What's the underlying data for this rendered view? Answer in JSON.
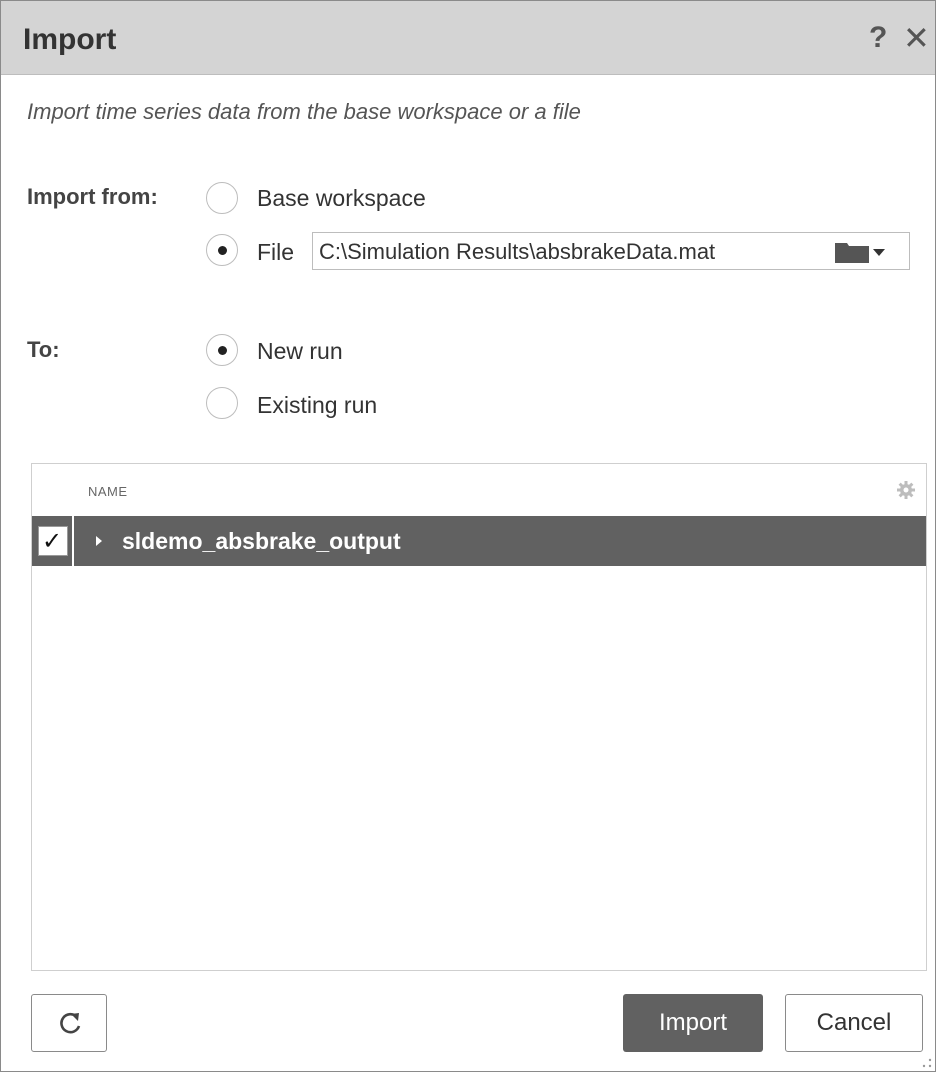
{
  "dialog": {
    "title": "Import",
    "help_label": "?",
    "close_label": "✕"
  },
  "description": "Import time series data from the base workspace or a file",
  "import_from": {
    "label": "Import from:",
    "options": [
      {
        "label": "Base workspace",
        "checked": false
      },
      {
        "label": "File",
        "checked": true
      }
    ],
    "file_path": "C:\\Simulation Results\\absbrakeData.mat",
    "browse_icon": "folder-icon",
    "dropdown_icon": "chevron-down-icon"
  },
  "to": {
    "label": "To:",
    "options": [
      {
        "label": "New run",
        "checked": true
      },
      {
        "label": "Existing run",
        "checked": false
      }
    ]
  },
  "table": {
    "column_header": "NAME",
    "settings_icon": "gear-icon",
    "rows": [
      {
        "name": "sldemo_absbrake_output",
        "checked": true,
        "selected": true
      }
    ]
  },
  "footer": {
    "refresh_icon": "refresh-icon",
    "import_label": "Import",
    "cancel_label": "Cancel"
  },
  "colors": {
    "titlebar": "#d4d4d4",
    "selected_row": "#616161",
    "primary_button": "#616161"
  }
}
